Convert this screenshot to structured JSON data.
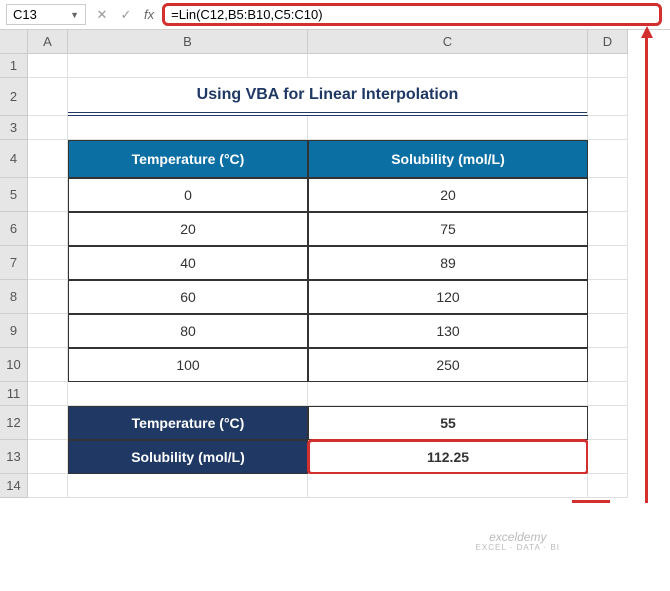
{
  "formula_bar": {
    "name_box": "C13",
    "cancel": "✕",
    "ok": "✓",
    "fx": "fx",
    "formula": "=Lin(C12,B5:B10,C5:C10)"
  },
  "columns": [
    "A",
    "B",
    "C",
    "D"
  ],
  "rows": [
    "1",
    "2",
    "3",
    "4",
    "5",
    "6",
    "7",
    "8",
    "9",
    "10",
    "11",
    "12",
    "13",
    "14"
  ],
  "title": "Using VBA for Linear Interpolation",
  "table": {
    "head_temp": "Temperature (°C)",
    "head_sol": "Solubility (mol/L)",
    "rows": [
      {
        "t": "0",
        "s": "20"
      },
      {
        "t": "20",
        "s": "75"
      },
      {
        "t": "40",
        "s": "89"
      },
      {
        "t": "60",
        "s": "120"
      },
      {
        "t": "80",
        "s": "130"
      },
      {
        "t": "100",
        "s": "250"
      }
    ]
  },
  "inputs": {
    "temp_label": "Temperature (°C)",
    "temp_value": "55",
    "sol_label": "Solubility (mol/L)",
    "sol_value": "112.25"
  },
  "watermark": {
    "main": "exceldemy",
    "sub": "EXCEL · DATA · BI"
  },
  "chart_data": {
    "type": "table",
    "title": "Using VBA for Linear Interpolation",
    "columns": [
      "Temperature (°C)",
      "Solubility (mol/L)"
    ],
    "rows": [
      [
        0,
        20
      ],
      [
        20,
        75
      ],
      [
        40,
        89
      ],
      [
        60,
        120
      ],
      [
        80,
        130
      ],
      [
        100,
        250
      ]
    ],
    "interpolation": {
      "x": 55,
      "y": 112.25,
      "formula": "=Lin(C12,B5:B10,C5:C10)"
    }
  }
}
